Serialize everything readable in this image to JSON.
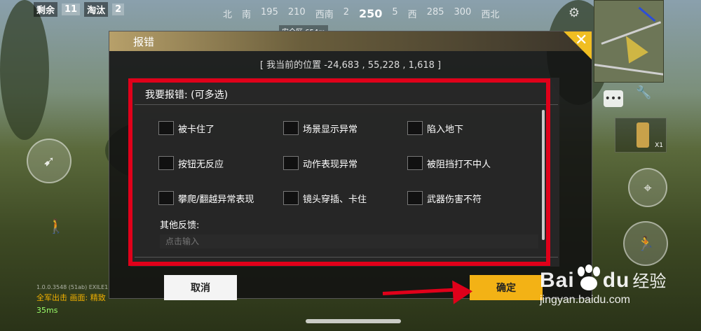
{
  "hud": {
    "alive_label": "剩余",
    "alive_count": "11",
    "kills_label": "淘汰",
    "kills_count": "2",
    "compass_ticks": [
      "北",
      "南",
      "195",
      "210",
      "西南",
      "2"
    ],
    "compass_heading": "250",
    "compass_ticks_right": [
      "5",
      "西",
      "285",
      "300",
      "西北"
    ],
    "safe_zone": "安全区 654m",
    "item_qty": "X1",
    "device_info": "1.0.0.3548 (51ab) EXILE1",
    "graphics_label": "全军出击 画面: 精致",
    "ping": "35ms"
  },
  "dialog": {
    "title": "报错",
    "location": "[ 我当前的位置 -24,683 , 55,228 , 1,618 ]",
    "section_title": "我要报错: (可多选)",
    "options": [
      "被卡住了",
      "场景显示异常",
      "陷入地下",
      "按钮无反应",
      "动作表现异常",
      "被阻挡打不中人",
      "攀爬/翻越异常表现",
      "镜头穿插、卡住",
      "武器伤害不符"
    ],
    "other_label": "其他反馈:",
    "other_placeholder": "点击输入",
    "cancel_label": "取消",
    "confirm_label": "确定"
  },
  "watermark": {
    "brand_left": "Bai",
    "brand_right": "du",
    "brand_cn": "经验",
    "url": "jingyan.baidu.com"
  },
  "colors": {
    "accent": "#f3b215",
    "annotation_red": "#e0001a"
  }
}
